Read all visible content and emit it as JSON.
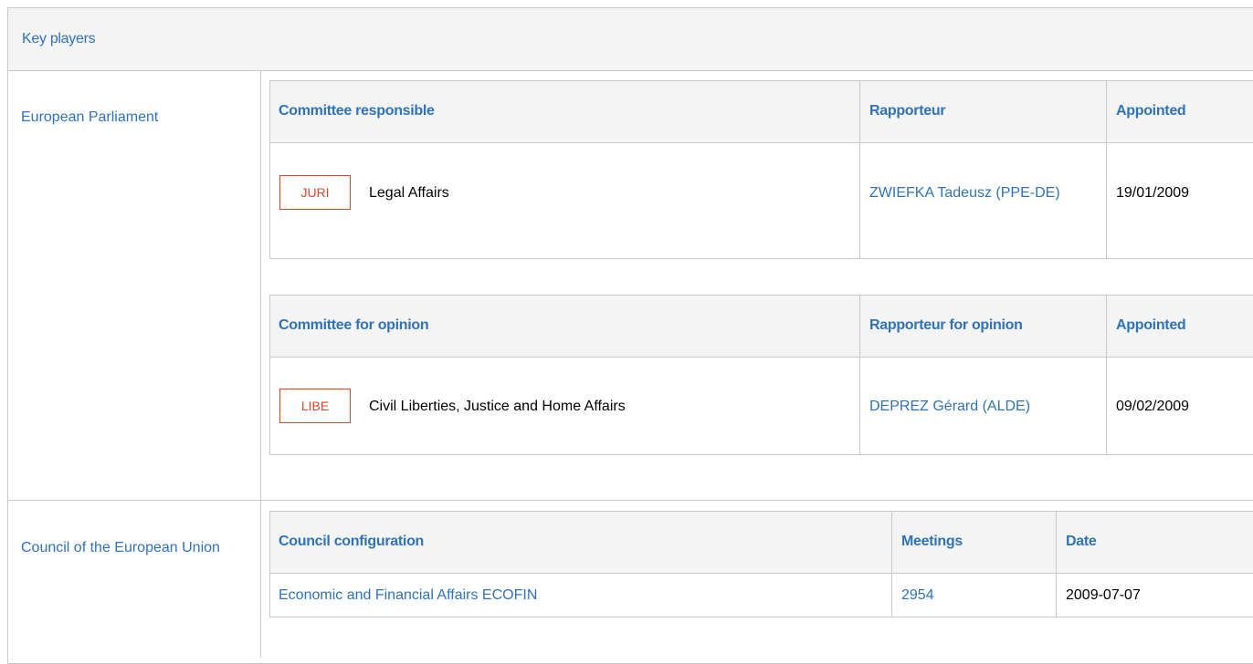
{
  "header": {
    "title": "Key players"
  },
  "parliament": {
    "label": "European Parliament",
    "responsible": {
      "headers": {
        "committee": "Committee responsible",
        "rapporteur": "Rapporteur",
        "appointed": "Appointed"
      },
      "row": {
        "badge": "JURI",
        "name": "Legal Affairs",
        "rapporteur": "ZWIEFKA Tadeusz (PPE-DE)",
        "appointed": "19/01/2009"
      }
    },
    "opinion": {
      "headers": {
        "committee": "Committee for opinion",
        "rapporteur": "Rapporteur for opinion",
        "appointed": "Appointed"
      },
      "row": {
        "badge": "LIBE",
        "name": "Civil Liberties, Justice and Home Affairs",
        "rapporteur": "DEPREZ Gérard (ALDE)",
        "appointed": "09/02/2009"
      }
    }
  },
  "council": {
    "label": "Council of the European Union",
    "headers": {
      "configuration": "Council configuration",
      "meetings": "Meetings",
      "date": "Date"
    },
    "row": {
      "configuration": "Economic and Financial Affairs ECOFIN",
      "meetings": "2954",
      "date": "2009-07-07"
    }
  },
  "colors": {
    "link": "#2f73b6",
    "badge": "#d9472b",
    "header_bg": "#f4f4f4",
    "border": "#c8c8c8"
  }
}
